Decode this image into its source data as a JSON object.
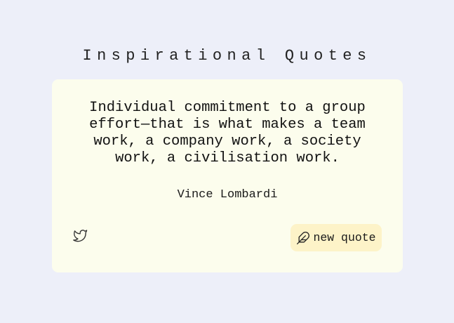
{
  "header": {
    "title": "Inspirational Quotes"
  },
  "quote": {
    "text": "Individual commitment to a group effort—that is what makes a team work, a company work, a society work, a civilisation work.",
    "author": "Vince Lombardi"
  },
  "actions": {
    "tweet_icon": "twitter-icon",
    "new_quote_icon": "feather-icon",
    "new_quote_label": "new quote"
  },
  "colors": {
    "background": "#edeff9",
    "card": "#fcfded",
    "button": "#fdf3c8"
  }
}
